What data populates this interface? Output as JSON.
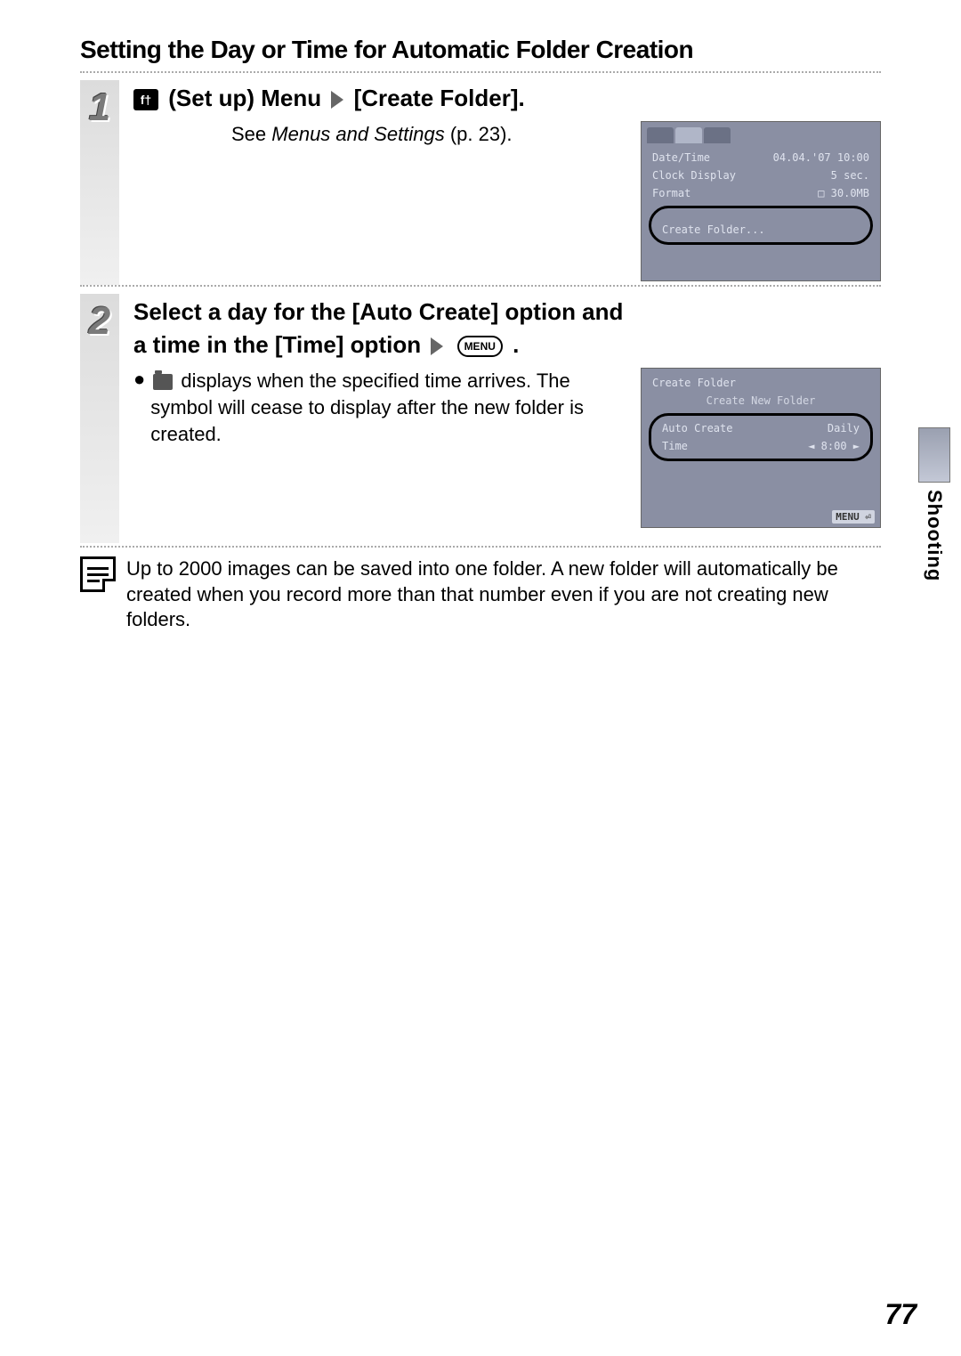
{
  "title": "Setting the Day or Time for Automatic Folder Creation",
  "step1": {
    "number": "1",
    "heading_prefix": "(Set up) Menu",
    "heading_suffix": "[Create Folder].",
    "subtext_prefix": "See ",
    "subtext_italic": "Menus and Settings",
    "subtext_suffix": " (p. 23).",
    "screenshot": {
      "rows": [
        {
          "label": "Date/Time",
          "value": "04.04.'07 10:00"
        },
        {
          "label": "Clock Display",
          "value": "5 sec."
        },
        {
          "label": "Format",
          "value": "□  30.0MB"
        }
      ],
      "highlight": "Create Folder..."
    }
  },
  "step2": {
    "number": "2",
    "heading_line1": "Select a day for the [Auto Create] option and",
    "heading_line2_prefix": "a time in the [Time] option",
    "menu_button_label": "MENU",
    "heading_line2_suffix": ".",
    "bullet_text": "displays when the specified time arrives. The symbol will cease to display after the new folder is created.",
    "screenshot": {
      "title": "Create Folder",
      "row1": {
        "label": "Create New Folder",
        "value": ""
      },
      "oval_rows": [
        {
          "label": "Auto Create",
          "value": "Daily"
        },
        {
          "label": "Time",
          "value": "◄ 8:00 ►"
        }
      ],
      "menu_back": "MENU ⏎"
    }
  },
  "note": {
    "text": "Up to 2000 images can be saved into one folder. A new folder will automatically be created when you record more than that number even if you are not creating new folders."
  },
  "side_tab": "Shooting",
  "page_number": "77"
}
